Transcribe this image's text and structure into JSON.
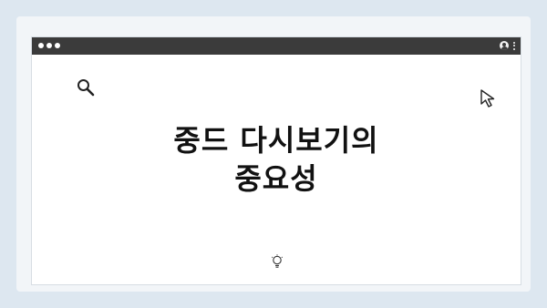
{
  "header": {
    "title_line1": "중드 다시보기의",
    "title_line2": "중요성"
  },
  "icons": {
    "search": "search-icon",
    "cursor": "cursor-arrow-icon",
    "bulb": "lightbulb-icon",
    "user": "user-icon",
    "menu": "kebab-menu-icon"
  },
  "colors": {
    "background": "#dde7f0",
    "titlebar": "#3b3b3b",
    "window": "#ffffff",
    "text": "#111111"
  }
}
